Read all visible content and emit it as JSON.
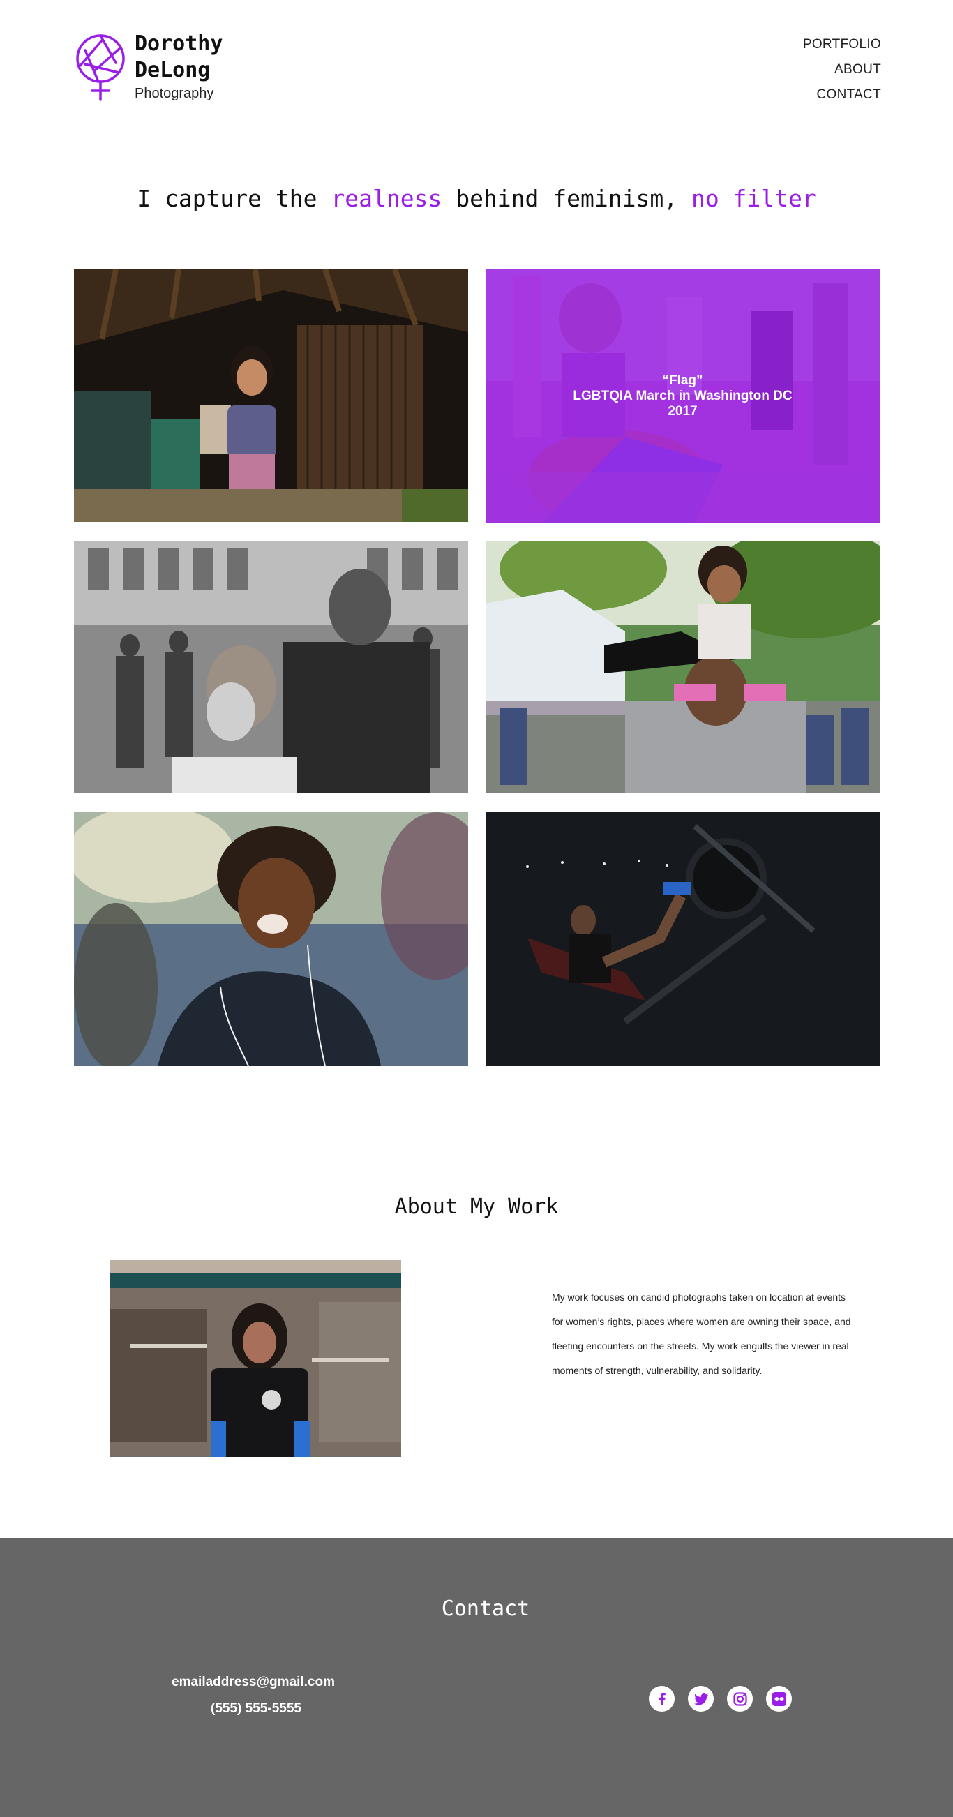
{
  "brand": {
    "name": "Dorothy DeLong",
    "subtitle": "Photography",
    "accent_color": "#9a1ee8",
    "logo_icon": "aperture-venus-icon"
  },
  "nav": {
    "items": [
      {
        "label": "PORTFOLIO"
      },
      {
        "label": "ABOUT"
      },
      {
        "label": "CONTACT"
      }
    ]
  },
  "tagline": {
    "part1": "I capture the ",
    "highlight1": "realness",
    "part2": " behind feminism, ",
    "highlight2": "no filter"
  },
  "portfolio": {
    "hovered_caption": {
      "title": "“Flag”",
      "line2": "LGBTQIA March in Washington DC",
      "line3": "2017"
    }
  },
  "about": {
    "title": "About My Work",
    "body": "My work focuses on candid photographs taken on location at events for women’s rights, places where women are owning their space, and fleeting encounters on the streets. My work engulfs the viewer in real moments of strength, vulnerability, and solidarity."
  },
  "contact": {
    "title": "Contact",
    "email": "emailaddress@gmail.com",
    "phone": "(555) 555-5555",
    "footer_bg": "#666666",
    "socials": [
      {
        "icon": "facebook-icon"
      },
      {
        "icon": "twitter-icon"
      },
      {
        "icon": "instagram-icon"
      },
      {
        "icon": "flickr-icon"
      }
    ]
  }
}
